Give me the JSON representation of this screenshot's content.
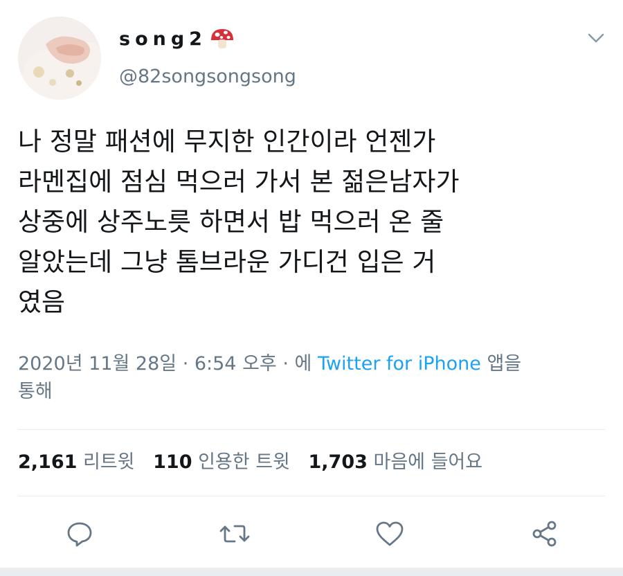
{
  "user": {
    "display_name": "song2",
    "handle": "@82songsongsong"
  },
  "tweet": {
    "text": "나 정말 패션에 무지한 인간이라 언젠가\n라멘집에 점심 먹으러 가서 본 젊은남자가\n상중에 상주노릇 하면서 밥 먹으러 온 줄\n알았는데 그냥 톰브라운 가디건 입은 거\n였음",
    "timestamp": "2020년 11월 28일 · 6:54 오후 · 에",
    "source": "Twitter for iPhone",
    "source_suffix": "앱을\n통해"
  },
  "stats": {
    "retweets_count": "2,161",
    "retweets_label": "리트윗",
    "quotes_count": "110",
    "quotes_label": "인용한 트윗",
    "likes_count": "1,703",
    "likes_label": "마음에 들어요"
  },
  "icons": {
    "mushroom": "mushroom-emoji",
    "chevron": "chevron-down-icon",
    "reply": "reply-icon",
    "retweet": "retweet-icon",
    "like": "heart-icon",
    "share": "share-icon"
  },
  "colors": {
    "text": "#14171a",
    "secondary": "#657786",
    "link": "#1da1f2",
    "divider": "#e6ecf0"
  }
}
